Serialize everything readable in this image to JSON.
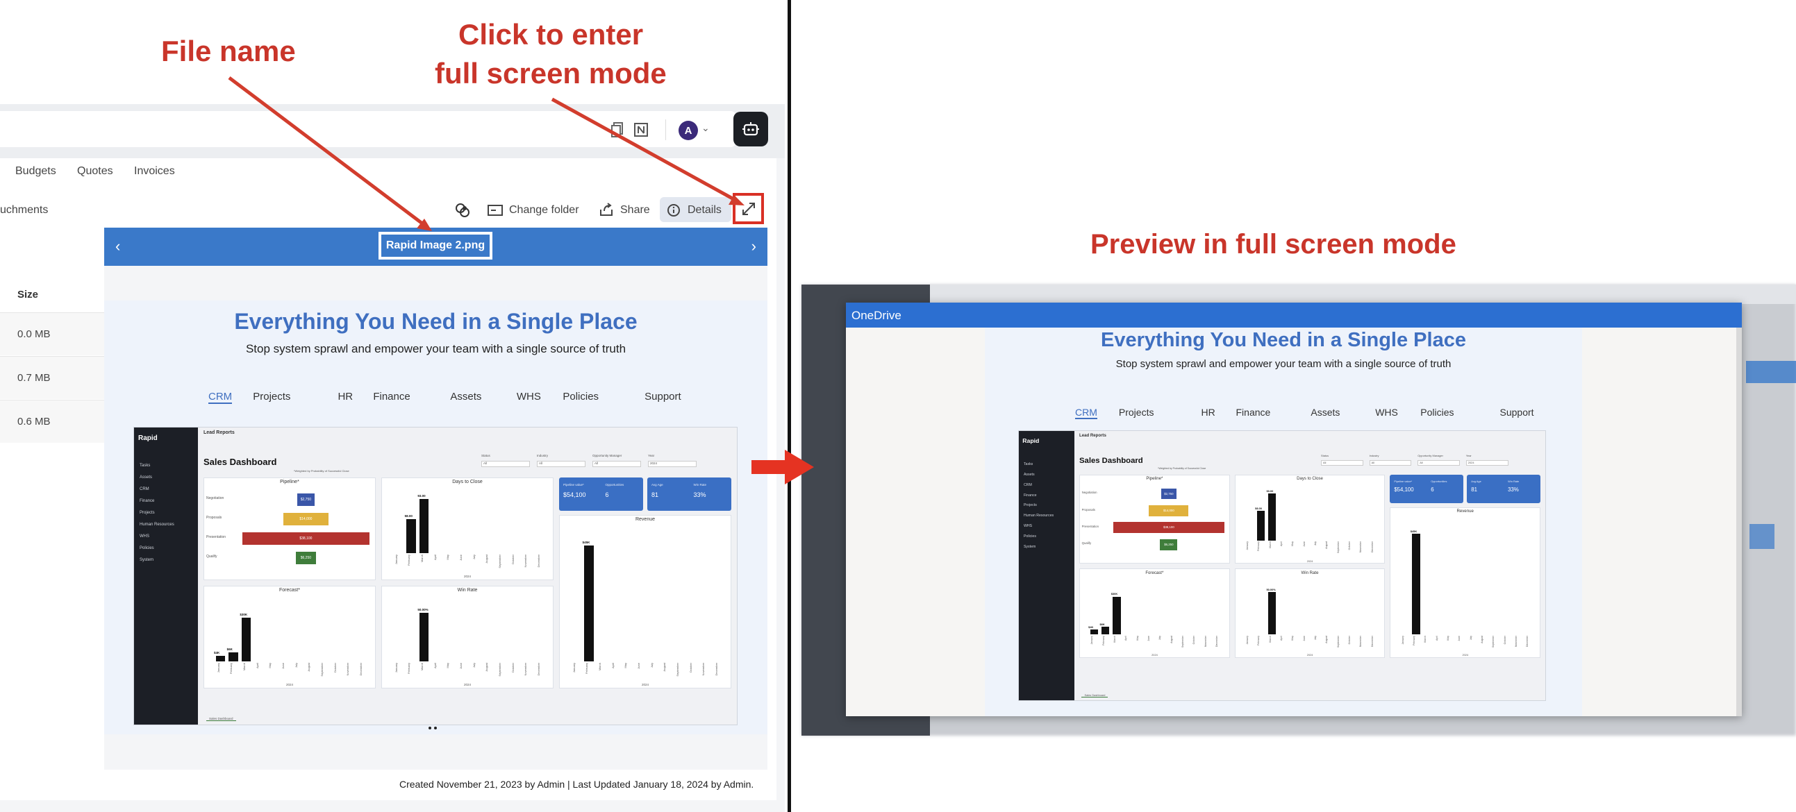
{
  "annotations": {
    "file_name": "File name",
    "full_screen_line1": "Click to enter",
    "full_screen_line2": "full screen mode",
    "preview_full": "Preview in full screen mode"
  },
  "app": {
    "tabs": [
      "Budgets",
      "Quotes",
      "Invoices"
    ],
    "toolbar": {
      "attachments_partial": "uchments",
      "change_folder": "Change folder",
      "share": "Share",
      "details": "Details"
    },
    "avatar_initial": "A",
    "size_header": "Size",
    "sizes": [
      "0.0 MB",
      "0.7 MB",
      "0.6 MB"
    ],
    "file_name": "Rapid Image 2.png",
    "footer": "Created November 21, 2023 by Admin | Last Updated January 18, 2024 by Admin."
  },
  "marketing": {
    "headline": "Everything You Need in a Single Place",
    "subhead": "Stop system sprawl and empower your team with a single source of truth",
    "tabs": [
      "CRM",
      "Projects",
      "HR",
      "Finance",
      "Assets",
      "WHS",
      "Policies",
      "Support"
    ],
    "sidebar_logo": "Rapid",
    "sidebar_items": [
      "Tasks",
      "Assets",
      "CRM",
      "Finance",
      "Projects",
      "Human Resources",
      "WHS",
      "Policies",
      "System"
    ],
    "report_title": "Lead Reports",
    "dashboard_title": "Sales Dashboard",
    "dashboard_note": "*Weighted by Probability of Successful Close",
    "filters": [
      "Status",
      "Industry",
      "Opportunity Manager",
      "Year"
    ],
    "filter_all": "All",
    "filter_year": "2024",
    "cards": {
      "pipeline": "Pipeline*",
      "days_to_close": "Days to Close",
      "forecast": "Forecast*",
      "win_rate": "Win Rate",
      "revenue": "Revenue"
    },
    "pipeline_stages": [
      {
        "label": "Negotiation",
        "value": "$2,750"
      },
      {
        "label": "Proposals",
        "value": "$14,000"
      },
      {
        "label": "Presentation",
        "value": "$38,100"
      },
      {
        "label": "Qualify",
        "value": "$6,250"
      }
    ],
    "kpis": [
      {
        "label": "Pipeline value*",
        "value": "$54,100"
      },
      {
        "label": "Opportunities",
        "value": "6"
      },
      {
        "label": "Avg Age",
        "value": "81"
      },
      {
        "label": "Win Rate",
        "value": "33%"
      }
    ],
    "months": [
      "January",
      "February",
      "March",
      "April",
      "May",
      "June",
      "July",
      "August",
      "September",
      "October",
      "November",
      "December"
    ],
    "days_values": [
      0,
      58,
      93,
      0,
      0,
      0,
      0,
      0,
      0,
      0,
      0,
      0
    ],
    "days_labels": [
      "",
      "58.00",
      "93.00"
    ],
    "forecast_values": [
      4,
      6,
      30,
      0,
      0,
      0,
      0,
      0,
      0,
      0,
      0,
      0
    ],
    "forecast_labels": [
      "$4K",
      "$6K",
      "$30K"
    ],
    "winrate_values": [
      0,
      0,
      50,
      0,
      0,
      0,
      0,
      0,
      0,
      0,
      0,
      0
    ],
    "winrate_label": "50.00%",
    "revenue_values": [
      0,
      45,
      0,
      0,
      0,
      0,
      0,
      0,
      0,
      0,
      0,
      0
    ],
    "revenue_label": "$45K",
    "year_axis": "2024",
    "bottom_tab": "Sales Dashboard"
  },
  "onedrive": {
    "title": "OneDrive"
  },
  "colors": {
    "accent_blue": "#3a79c9",
    "annotation_red": "#c9352a",
    "highlight_red": "#d93025"
  }
}
